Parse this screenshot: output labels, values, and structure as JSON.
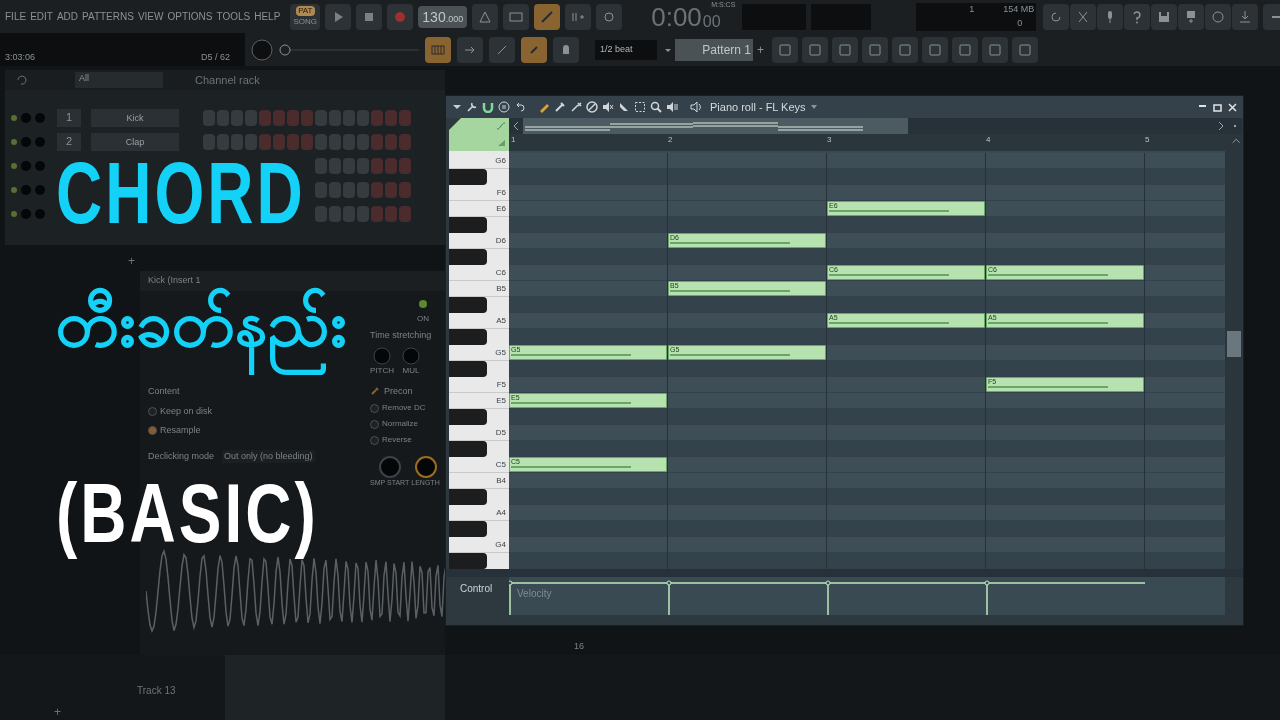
{
  "menu": [
    "FILE",
    "EDIT",
    "ADD",
    "PATTERNS",
    "VIEW",
    "OPTIONS",
    "TOOLS",
    "HELP"
  ],
  "transport": {
    "hint_time": "3:03:06",
    "hint_note": "D5 / 62",
    "modes": [
      {
        "label": "PAT",
        "selected": true
      },
      {
        "label": "SONG",
        "selected": false
      }
    ],
    "position": {
      "level": 0
    },
    "tempo": "130",
    "tempo_decimal": ".000",
    "time_unit": "M:S:CS",
    "time": "0:00",
    "time_small": "00",
    "cpu": "1",
    "memory": "154 MB",
    "poly": "0",
    "snap": "1/2 beat",
    "pattern": "Pattern 1",
    "pattern_add": "+"
  },
  "channel_rack": {
    "filter": "All",
    "title": "Channel rack",
    "channels": [
      {
        "number": "1",
        "name": "Kick"
      },
      {
        "number": "2",
        "name": "Clap"
      }
    ],
    "add": "+"
  },
  "sampler": {
    "title": "Kick (Insert 1",
    "on_label": "ON",
    "time_stretching": "Time stretching",
    "knobs": [
      "PITCH",
      "MUL"
    ],
    "content": "Content",
    "options": [
      {
        "label": "Keep on disk",
        "checked": false
      },
      {
        "label": "Resample",
        "checked": true
      }
    ],
    "declicking_label": "Declicking mode",
    "declicking_value": "Out only (no bleeding)",
    "precomputed": "Precon",
    "effects": [
      {
        "label": "Remove DC",
        "checked": false
      },
      {
        "label": "Normalize",
        "checked": false
      },
      {
        "label": "Reverse",
        "checked": false
      }
    ],
    "bottom_knobs": [
      "SMP START",
      "LENGTH"
    ]
  },
  "playlist": {
    "track": "Track 13",
    "number": "16",
    "add": "+"
  },
  "title": {
    "line1": "CHORD",
    "line2": "တီးခတ်နည်း",
    "line3": "(BASIC)"
  },
  "piano_roll": {
    "title": "Piano roll - FL Keys",
    "ruler": [
      "1",
      "2",
      "3",
      "4",
      "5"
    ],
    "control_label": "Control",
    "control_target": "Velocity",
    "rows": [
      {
        "kind": "white",
        "key": "G6",
        "slots": [
          {
            "on": false
          },
          {
            "on": false
          },
          {
            "on": false
          },
          {
            "on": false
          }
        ]
      },
      {
        "kind": "black",
        "slots": [
          {
            "on": false
          },
          {
            "on": false
          },
          {
            "on": false
          },
          {
            "on": false
          }
        ]
      },
      {
        "kind": "white",
        "key": "F6",
        "slots": [
          {
            "on": false
          },
          {
            "on": false
          },
          {
            "on": false
          },
          {
            "on": false
          }
        ]
      },
      {
        "kind": "white",
        "key": "E6",
        "slots": [
          {
            "on": false
          },
          {
            "on": false
          },
          {
            "on": true,
            "label": "E6"
          },
          {
            "on": false
          }
        ]
      },
      {
        "kind": "black",
        "slots": [
          {
            "on": false
          },
          {
            "on": false
          },
          {
            "on": false
          },
          {
            "on": false
          }
        ]
      },
      {
        "kind": "white",
        "key": "D6",
        "slots": [
          {
            "on": false
          },
          {
            "on": true,
            "label": "D6"
          },
          {
            "on": false
          },
          {
            "on": false
          }
        ]
      },
      {
        "kind": "black",
        "slots": [
          {
            "on": false
          },
          {
            "on": false
          },
          {
            "on": false
          },
          {
            "on": false
          }
        ]
      },
      {
        "kind": "white",
        "key": "C6",
        "slots": [
          {
            "on": false
          },
          {
            "on": false
          },
          {
            "on": true,
            "label": "C6"
          },
          {
            "on": true,
            "label": "C6"
          }
        ]
      },
      {
        "kind": "white",
        "key": "B5",
        "slots": [
          {
            "on": false
          },
          {
            "on": true,
            "label": "B5"
          },
          {
            "on": false
          },
          {
            "on": false
          }
        ]
      },
      {
        "kind": "black",
        "slots": [
          {
            "on": false
          },
          {
            "on": false
          },
          {
            "on": false
          },
          {
            "on": false
          }
        ]
      },
      {
        "kind": "white",
        "key": "A5",
        "slots": [
          {
            "on": false
          },
          {
            "on": false
          },
          {
            "on": true,
            "label": "A5"
          },
          {
            "on": true,
            "label": "A5"
          }
        ]
      },
      {
        "kind": "black",
        "slots": [
          {
            "on": false
          },
          {
            "on": false
          },
          {
            "on": false
          },
          {
            "on": false
          }
        ]
      },
      {
        "kind": "white",
        "key": "G5",
        "slots": [
          {
            "on": true,
            "label": "G5"
          },
          {
            "on": true,
            "label": "G5"
          },
          {
            "on": false
          },
          {
            "on": false
          }
        ]
      },
      {
        "kind": "black",
        "slots": [
          {
            "on": false
          },
          {
            "on": false
          },
          {
            "on": false
          },
          {
            "on": false
          }
        ]
      },
      {
        "kind": "white",
        "key": "F5",
        "slots": [
          {
            "on": false
          },
          {
            "on": false
          },
          {
            "on": false
          },
          {
            "on": true,
            "label": "F5"
          }
        ]
      },
      {
        "kind": "white",
        "key": "E5",
        "slots": [
          {
            "on": true,
            "label": "E5"
          },
          {
            "on": false
          },
          {
            "on": false
          },
          {
            "on": false
          }
        ]
      },
      {
        "kind": "black",
        "slots": [
          {
            "on": false
          },
          {
            "on": false
          },
          {
            "on": false
          },
          {
            "on": false
          }
        ]
      },
      {
        "kind": "white",
        "key": "D5",
        "slots": [
          {
            "on": false
          },
          {
            "on": false
          },
          {
            "on": false
          },
          {
            "on": false
          }
        ]
      },
      {
        "kind": "black",
        "slots": [
          {
            "on": false
          },
          {
            "on": false
          },
          {
            "on": false
          },
          {
            "on": false
          }
        ]
      },
      {
        "kind": "white",
        "key": "C5",
        "slots": [
          {
            "on": true,
            "label": "C5"
          },
          {
            "on": false
          },
          {
            "on": false
          },
          {
            "on": false
          }
        ]
      },
      {
        "kind": "white",
        "key": "B4",
        "slots": [
          {
            "on": false
          },
          {
            "on": false
          },
          {
            "on": false
          },
          {
            "on": false
          }
        ]
      },
      {
        "kind": "black",
        "slots": [
          {
            "on": false
          },
          {
            "on": false
          },
          {
            "on": false
          },
          {
            "on": false
          }
        ]
      },
      {
        "kind": "white",
        "key": "A4",
        "slots": [
          {
            "on": false
          },
          {
            "on": false
          },
          {
            "on": false
          },
          {
            "on": false
          }
        ]
      },
      {
        "kind": "black",
        "slots": [
          {
            "on": false
          },
          {
            "on": false
          },
          {
            "on": false
          },
          {
            "on": false
          }
        ]
      },
      {
        "kind": "white",
        "key": "G4",
        "slots": [
          {
            "on": false
          },
          {
            "on": false
          },
          {
            "on": false
          },
          {
            "on": false
          }
        ]
      },
      {
        "kind": "black",
        "slots": [
          {
            "on": false
          },
          {
            "on": false
          },
          {
            "on": false
          },
          {
            "on": false
          }
        ]
      }
    ]
  }
}
